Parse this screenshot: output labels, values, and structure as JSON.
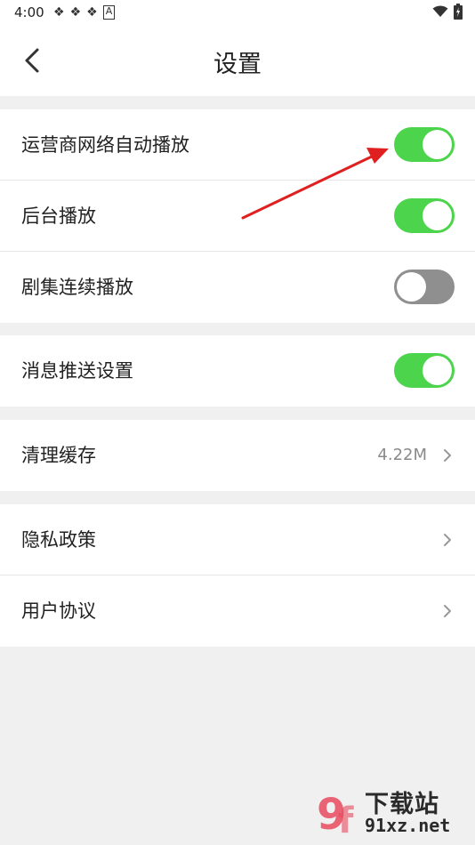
{
  "status_bar": {
    "time": "4:00",
    "left_icons": [
      "notification-icon",
      "notification-icon",
      "notification-icon",
      "a-icon"
    ],
    "right_icons": [
      "wifi-icon",
      "battery-icon"
    ]
  },
  "header": {
    "title": "设置",
    "back_icon": "chevron-left-icon"
  },
  "groups": [
    {
      "rows": [
        {
          "label": "运营商网络自动播放",
          "toggle": true
        },
        {
          "label": "后台播放",
          "toggle": true
        },
        {
          "label": "剧集连续播放",
          "toggle": false
        }
      ]
    },
    {
      "rows": [
        {
          "label": "消息推送设置",
          "toggle": true
        }
      ]
    },
    {
      "rows": [
        {
          "label": "清理缓存",
          "value": "4.22M",
          "chevron": true
        }
      ]
    },
    {
      "rows": [
        {
          "label": "隐私政策",
          "chevron": true
        },
        {
          "label": "用户协议",
          "chevron": true
        }
      ]
    }
  ],
  "colors": {
    "toggle_on": "#4cd44c",
    "toggle_off": "#8f8f8f",
    "background": "#f0f0f0",
    "annotation_arrow": "#e02020"
  },
  "watermark": {
    "logo_text": "9f",
    "top_text": "下载站",
    "bottom_text": "91xz.net"
  }
}
